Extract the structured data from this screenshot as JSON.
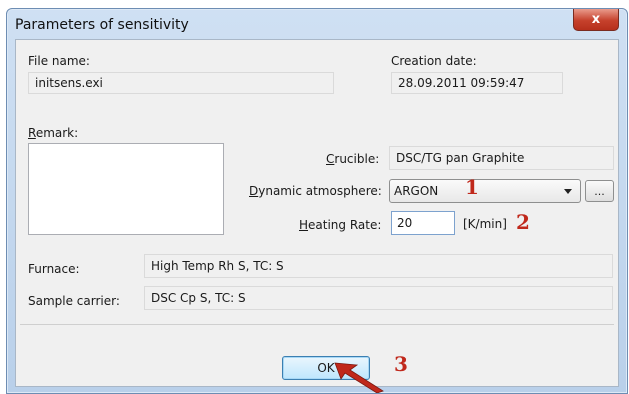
{
  "window": {
    "title": "Parameters of sensitivity",
    "close_glyph": "x"
  },
  "file": {
    "label": "File name:",
    "value": "initsens.exi"
  },
  "creation": {
    "label": "Creation date:",
    "value": "28.09.2011 09:59:47"
  },
  "remark": {
    "label_accel": "R",
    "label_rest": "emark:"
  },
  "crucible": {
    "label_accel": "C",
    "label_rest": "rucible:",
    "value": "DSC/TG pan Graphite"
  },
  "atmosphere": {
    "label_accel": "D",
    "label_rest": "ynamic atmosphere:",
    "value": "ARGON",
    "browse_label": "..."
  },
  "heating": {
    "label_accel": "H",
    "label_rest": "eating Rate:",
    "value": "20",
    "unit": "[K/min]"
  },
  "furnace": {
    "label": "Furnace:",
    "value": "High Temp Rh S, TC: S"
  },
  "carrier": {
    "label": "Sample carrier:",
    "value": "DSC Cp S, TC: S"
  },
  "ok": {
    "label": "OK"
  },
  "annotations": {
    "n1": "1",
    "n2": "2",
    "n3": "3",
    "color": "#c0281b"
  },
  "colors": {
    "title_bar": "#b9d0ea",
    "close_button": "#c6412c",
    "dialog_bg": "#f0f0f0"
  }
}
